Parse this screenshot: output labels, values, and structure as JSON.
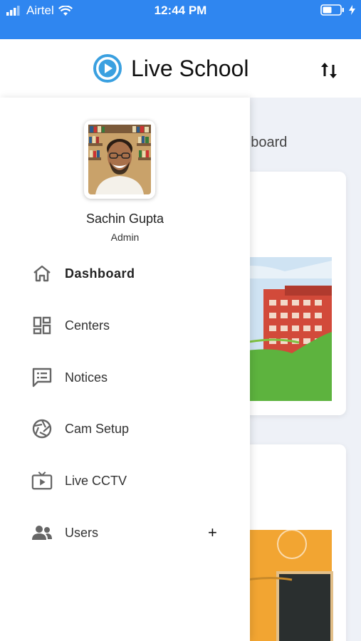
{
  "status_bar": {
    "carrier": "Airtel",
    "time": "12:44 PM"
  },
  "header": {
    "app_title": "Live School"
  },
  "background": {
    "page_title": "ashboard"
  },
  "user": {
    "name": "Sachin Gupta",
    "role": "Admin"
  },
  "menu": [
    {
      "label": "Dashboard",
      "icon": "home-icon"
    },
    {
      "label": "Centers",
      "icon": "dashboard-grid-icon"
    },
    {
      "label": "Notices",
      "icon": "notice-icon"
    },
    {
      "label": "Cam Setup",
      "icon": "camera-shutter-icon"
    },
    {
      "label": "Live CCTV",
      "icon": "tv-play-icon"
    },
    {
      "label": "Users",
      "icon": "users-icon",
      "action": "+"
    }
  ],
  "colors": {
    "status_bar": "#2f86f0",
    "brand_accent": "#3aa0e0",
    "icon_gray": "#666666"
  }
}
